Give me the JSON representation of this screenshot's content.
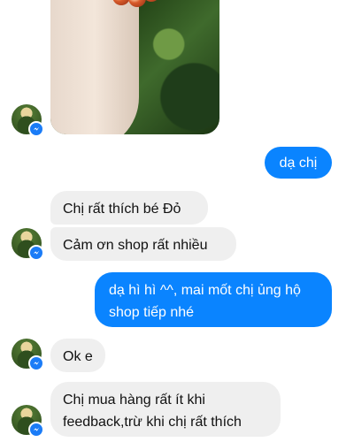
{
  "messages": [
    {
      "side": "outgoing",
      "text": "dạ chị"
    },
    {
      "side": "incoming",
      "text": "Chị rất thích bé Đỏ"
    },
    {
      "side": "incoming",
      "text": "Cảm ơn shop rất nhiều"
    },
    {
      "side": "outgoing",
      "text": "dạ hì hì ^^, mai mốt chị ủng hộ shop tiếp nhé"
    },
    {
      "side": "incoming",
      "text": "Ok e"
    },
    {
      "side": "incoming",
      "text": "Chị mua hàng rất ít khi feedback,trừ khi chị rất thích"
    }
  ],
  "colors": {
    "outgoing_bubble": "#0a84ff",
    "incoming_bubble": "#efefef",
    "messenger_badge": "#1b7cf7"
  }
}
